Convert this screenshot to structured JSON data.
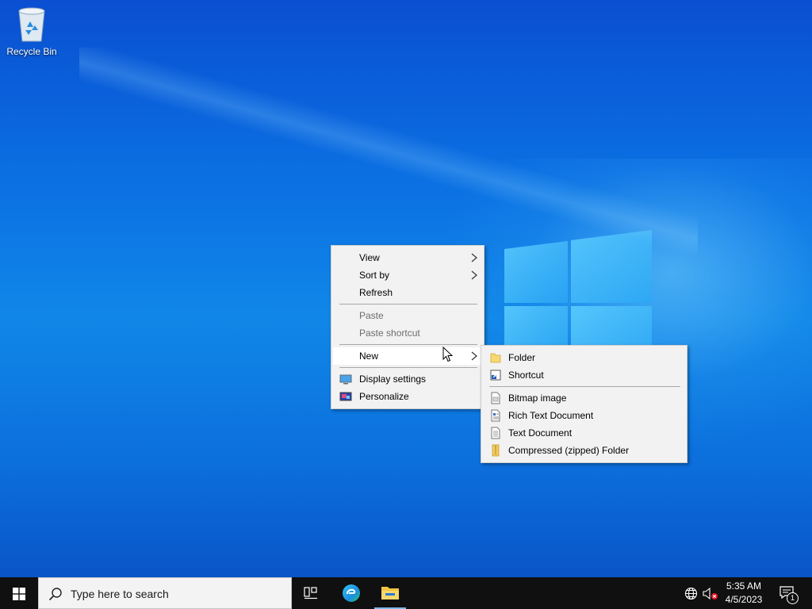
{
  "desktop": {
    "icons": [
      {
        "label": "Recycle Bin",
        "icon": "recycle-bin-icon"
      }
    ]
  },
  "context_menu": {
    "items": [
      {
        "label": "View",
        "has_submenu": true,
        "enabled": true
      },
      {
        "label": "Sort by",
        "has_submenu": true,
        "enabled": true
      },
      {
        "label": "Refresh",
        "enabled": true
      },
      {
        "label": "Paste",
        "enabled": false
      },
      {
        "label": "Paste shortcut",
        "enabled": false
      },
      {
        "label": "New",
        "has_submenu": true,
        "enabled": true,
        "highlighted": true
      },
      {
        "label": "Display settings",
        "icon": "display-settings-icon",
        "enabled": true
      },
      {
        "label": "Personalize",
        "icon": "personalize-icon",
        "enabled": true
      }
    ]
  },
  "new_submenu": {
    "items": [
      {
        "label": "Folder",
        "icon": "folder-icon"
      },
      {
        "label": "Shortcut",
        "icon": "shortcut-icon"
      },
      {
        "label": "Bitmap image",
        "icon": "bitmap-icon"
      },
      {
        "label": "Rich Text Document",
        "icon": "rich-text-icon"
      },
      {
        "label": "Text Document",
        "icon": "text-document-icon"
      },
      {
        "label": "Compressed (zipped) Folder",
        "icon": "zip-folder-icon"
      }
    ]
  },
  "taskbar": {
    "search_placeholder": "Type here to search",
    "pinned": [
      "task-view-icon",
      "edge-icon",
      "file-explorer-icon"
    ],
    "tray": [
      "network-icon",
      "volume-muted-icon"
    ],
    "clock": {
      "time": "5:35 AM",
      "date": "4/5/2023"
    },
    "notification_count": "1"
  },
  "colors": {
    "desktop_blue": "#0b6fe2",
    "taskbar": "#101010",
    "menu_bg": "#f2f2f2",
    "search_bg": "#f3f3f3"
  }
}
